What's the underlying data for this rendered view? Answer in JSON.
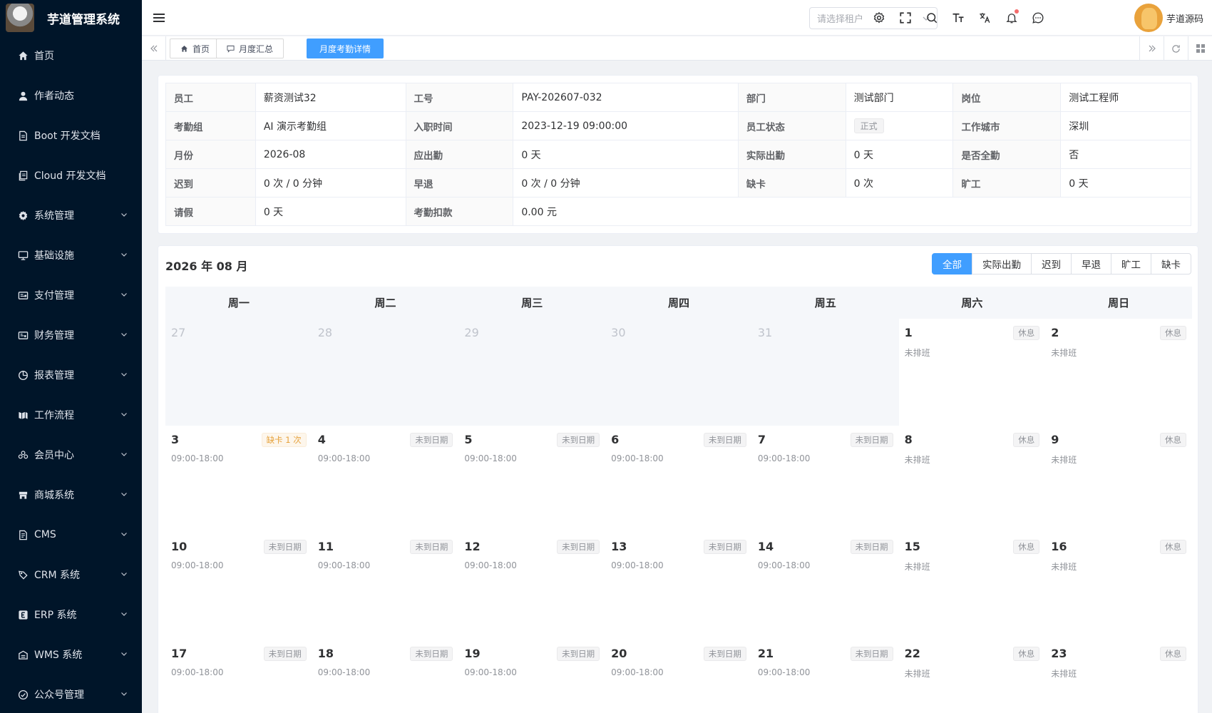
{
  "app": {
    "title": "芋道管理系统"
  },
  "sidebar": {
    "items": [
      {
        "label": "首页",
        "icon": "home-icon",
        "expandable": false
      },
      {
        "label": "作者动态",
        "icon": "user-icon",
        "expandable": false
      },
      {
        "label": "Boot 开发文档",
        "icon": "document-icon",
        "expandable": false
      },
      {
        "label": "Cloud 开发文档",
        "icon": "document-copy-icon",
        "expandable": false
      },
      {
        "label": "系统管理",
        "icon": "gear-icon",
        "expandable": true
      },
      {
        "label": "基础设施",
        "icon": "monitor-icon",
        "expandable": true
      },
      {
        "label": "支付管理",
        "icon": "wallet-icon",
        "expandable": true
      },
      {
        "label": "财务管理",
        "icon": "finance-icon",
        "expandable": true
      },
      {
        "label": "报表管理",
        "icon": "pie-chart-icon",
        "expandable": true
      },
      {
        "label": "工作流程",
        "icon": "flow-icon",
        "expandable": true
      },
      {
        "label": "会员中心",
        "icon": "members-icon",
        "expandable": true
      },
      {
        "label": "商城系统",
        "icon": "shop-icon",
        "expandable": true
      },
      {
        "label": "CMS",
        "icon": "cms-icon",
        "expandable": true
      },
      {
        "label": "CRM 系统",
        "icon": "crm-icon",
        "expandable": true
      },
      {
        "label": "ERP 系统",
        "icon": "erp-icon",
        "expandable": true
      },
      {
        "label": "WMS 系统",
        "icon": "warehouse-icon",
        "expandable": true
      },
      {
        "label": "公众号管理",
        "icon": "wechat-icon",
        "expandable": true
      }
    ]
  },
  "header": {
    "tenant_placeholder": "请选择租户",
    "user_name": "芋道源码"
  },
  "tags": [
    {
      "label": "首页",
      "icon": "home-icon",
      "active": false
    },
    {
      "label": "月度汇总",
      "icon": "chat-icon",
      "active": false
    },
    {
      "label": "月度考勤详情",
      "icon": "",
      "active": true
    }
  ],
  "info": {
    "rows": [
      [
        {
          "label": "员工",
          "value": "薪资测试32"
        },
        {
          "label": "工号",
          "value": "PAY-202607-032"
        },
        {
          "label": "部门",
          "value": "测试部门"
        },
        {
          "label": "岗位",
          "value": "测试工程师"
        }
      ],
      [
        {
          "label": "考勤组",
          "value": "AI 演示考勤组"
        },
        {
          "label": "入职时间",
          "value": "2023-12-19 09:00:00"
        },
        {
          "label": "员工状态",
          "value": "正式",
          "tag": true
        },
        {
          "label": "工作城市",
          "value": "深圳"
        }
      ],
      [
        {
          "label": "月份",
          "value": "2026-08"
        },
        {
          "label": "应出勤",
          "value": "0 天"
        },
        {
          "label": "实际出勤",
          "value": "0 天"
        },
        {
          "label": "是否全勤",
          "value": "否"
        }
      ],
      [
        {
          "label": "迟到",
          "value": "0 次 / 0 分钟"
        },
        {
          "label": "早退",
          "value": "0 次 / 0 分钟"
        },
        {
          "label": "缺卡",
          "value": "0 次"
        },
        {
          "label": "旷工",
          "value": "0 天"
        }
      ],
      [
        {
          "label": "请假",
          "value": "0 天"
        },
        {
          "label": "考勤扣款",
          "value": "0.00 元"
        }
      ]
    ]
  },
  "calendar": {
    "title": "2026 年 08 月",
    "filters": [
      {
        "label": "全部",
        "active": true
      },
      {
        "label": "实际出勤",
        "active": false
      },
      {
        "label": "迟到",
        "active": false
      },
      {
        "label": "早退",
        "active": false
      },
      {
        "label": "旷工",
        "active": false
      },
      {
        "label": "缺卡",
        "active": false
      }
    ],
    "weekdays": [
      "周一",
      "周二",
      "周三",
      "周四",
      "周五",
      "周六",
      "周日"
    ],
    "days": [
      {
        "num": "27",
        "other": true
      },
      {
        "num": "28",
        "other": true
      },
      {
        "num": "29",
        "other": true
      },
      {
        "num": "30",
        "other": true
      },
      {
        "num": "31",
        "other": true
      },
      {
        "num": "1",
        "badge": "休息",
        "sub": "未排班"
      },
      {
        "num": "2",
        "badge": "休息",
        "sub": "未排班"
      },
      {
        "num": "3",
        "badge": "缺卡 1 次",
        "warn": true,
        "sub": "09:00-18:00"
      },
      {
        "num": "4",
        "badge": "未到日期",
        "sub": "09:00-18:00"
      },
      {
        "num": "5",
        "badge": "未到日期",
        "sub": "09:00-18:00"
      },
      {
        "num": "6",
        "badge": "未到日期",
        "sub": "09:00-18:00"
      },
      {
        "num": "7",
        "badge": "未到日期",
        "sub": "09:00-18:00"
      },
      {
        "num": "8",
        "badge": "休息",
        "sub": "未排班"
      },
      {
        "num": "9",
        "badge": "休息",
        "sub": "未排班"
      },
      {
        "num": "10",
        "badge": "未到日期",
        "sub": "09:00-18:00"
      },
      {
        "num": "11",
        "badge": "未到日期",
        "sub": "09:00-18:00"
      },
      {
        "num": "12",
        "badge": "未到日期",
        "sub": "09:00-18:00"
      },
      {
        "num": "13",
        "badge": "未到日期",
        "sub": "09:00-18:00"
      },
      {
        "num": "14",
        "badge": "未到日期",
        "sub": "09:00-18:00"
      },
      {
        "num": "15",
        "badge": "休息",
        "sub": "未排班"
      },
      {
        "num": "16",
        "badge": "休息",
        "sub": "未排班"
      },
      {
        "num": "17",
        "badge": "未到日期",
        "sub": "09:00-18:00"
      },
      {
        "num": "18",
        "badge": "未到日期",
        "sub": "09:00-18:00"
      },
      {
        "num": "19",
        "badge": "未到日期",
        "sub": "09:00-18:00"
      },
      {
        "num": "20",
        "badge": "未到日期",
        "sub": "09:00-18:00"
      },
      {
        "num": "21",
        "badge": "未到日期",
        "sub": "09:00-18:00"
      },
      {
        "num": "22",
        "badge": "休息",
        "sub": "未排班"
      },
      {
        "num": "23",
        "badge": "休息",
        "sub": "未排班"
      }
    ]
  },
  "colors": {
    "sidebar_bg": "#001529",
    "primary": "#409eff",
    "warning": "#e6a23c"
  }
}
